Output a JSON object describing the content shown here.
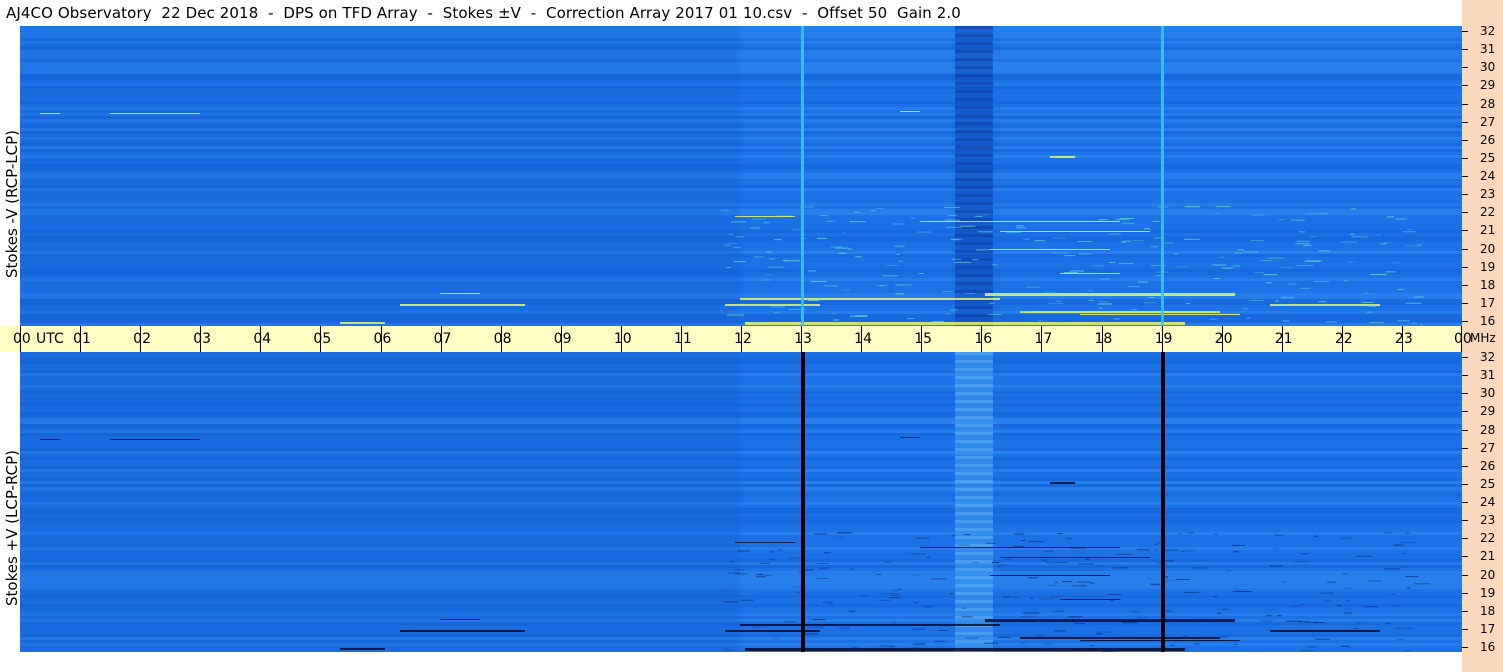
{
  "title": "AJ4CO Observatory  22 Dec 2018  -  DPS on TFD Array  -  Stokes ±V  -  Correction Array 2017 01 10.csv  -  Offset 50  Gain 2.0",
  "panels": {
    "top": {
      "label": "Stokes -V (RCP-LCP)"
    },
    "bottom": {
      "label": "Stokes +V (LCP-RCP)"
    }
  },
  "time_axis": {
    "labels": [
      "00",
      "01",
      "02",
      "03",
      "04",
      "05",
      "06",
      "07",
      "08",
      "09",
      "10",
      "11",
      "12",
      "13",
      "14",
      "15",
      "16",
      "17",
      "18",
      "19",
      "20",
      "21",
      "22",
      "23",
      "00"
    ],
    "utc_label": "UTC"
  },
  "freq_axis": {
    "labels": [
      "32",
      "31",
      "30",
      "29",
      "28",
      "27",
      "26",
      "25",
      "24",
      "23",
      "22",
      "21",
      "20",
      "19",
      "18",
      "17",
      "16"
    ],
    "unit": "MHz"
  },
  "colors": {
    "background_blue": "#1a6fe6",
    "time_axis_bg": "#fffdc2",
    "right_strip_bg": "#fad8bc"
  }
}
